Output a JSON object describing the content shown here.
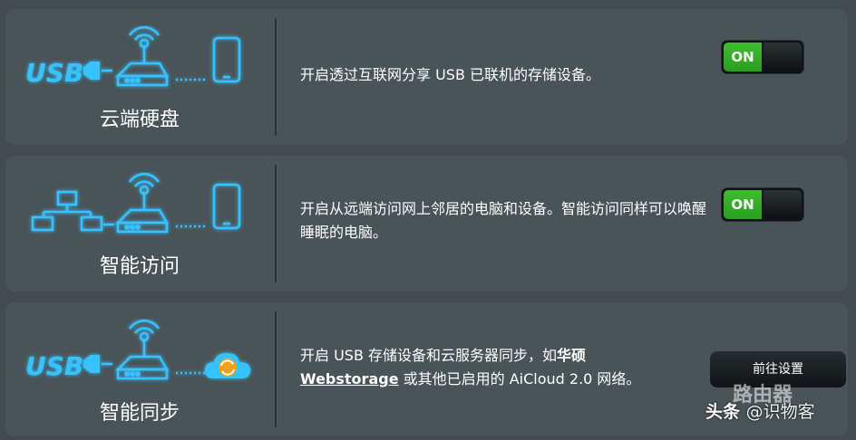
{
  "colors": {
    "background": "#434b4f",
    "panel": "#4a5357",
    "glow": "#35c2ff",
    "toggle_on": "#2fae22",
    "button": "#1a1f22"
  },
  "features": [
    {
      "name": "云端硬盘",
      "description": "开启透过互联网分享 USB 已联机的存储设备。",
      "graphic": [
        "usb-icon",
        "router-icon",
        "phone-icon"
      ],
      "toggle_label": "ON"
    },
    {
      "name": "智能访问",
      "description": "开启从远端访问网上邻居的电脑和设备。智能访问同样可以唤醒睡眠的电脑。",
      "graphic": [
        "network-computers-icon",
        "router-icon",
        "phone-icon"
      ],
      "toggle_label": "ON"
    },
    {
      "name": "智能同步",
      "description_part1": "开启 USB 存储设备和云服务器同步，如",
      "description_brand": "华硕",
      "description_link": "Webstorage",
      "description_part2": " 或其他已启用的 AiCloud 2.0 网络。",
      "graphic": [
        "usb-icon",
        "router-icon",
        "cloud-sync-icon"
      ],
      "button_label": "前往设置"
    }
  ],
  "watermark": {
    "brand": "头条",
    "handle": "@识物客",
    "overlay": "路由器"
  }
}
